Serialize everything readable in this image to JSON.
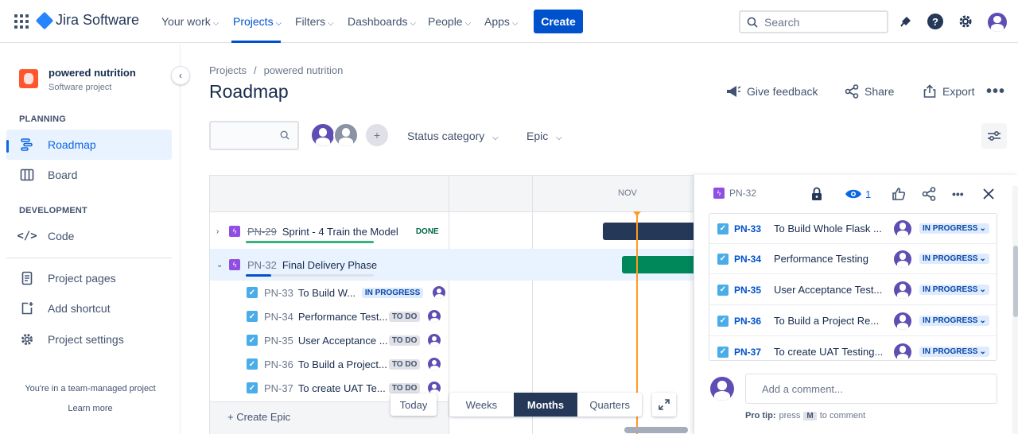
{
  "topnav": {
    "logo_text": "Jira Software",
    "items": [
      {
        "label": "Your work"
      },
      {
        "label": "Projects"
      },
      {
        "label": "Filters"
      },
      {
        "label": "Dashboards"
      },
      {
        "label": "People"
      },
      {
        "label": "Apps"
      }
    ],
    "create_label": "Create",
    "search_placeholder": "Search"
  },
  "sidebar": {
    "project_name": "powered nutrition",
    "project_type": "Software project",
    "planning_heading": "PLANNING",
    "development_heading": "DEVELOPMENT",
    "items": [
      {
        "label": "Roadmap",
        "icon": "roadmap-icon"
      },
      {
        "label": "Board",
        "icon": "board-icon"
      },
      {
        "label": "Code",
        "icon": "code-icon"
      },
      {
        "label": "Project pages",
        "icon": "pages-icon"
      },
      {
        "label": "Add shortcut",
        "icon": "add-shortcut-icon"
      },
      {
        "label": "Project settings",
        "icon": "gear-icon"
      }
    ],
    "team_managed_text": "You're in a team-managed project",
    "learn_more": "Learn more"
  },
  "header": {
    "breadcrumb": [
      "Projects",
      "/",
      "powered nutrition"
    ],
    "title": "Roadmap",
    "give_feedback": "Give feedback",
    "share": "Share",
    "export": "Export"
  },
  "filters": {
    "status_category": "Status category",
    "epic": "Epic"
  },
  "roadmap": {
    "month_label": "NOV",
    "rows": [
      {
        "key": "PN-29",
        "summary": "Sprint - 4 Train the Model",
        "status": "DONE"
      },
      {
        "key": "PN-32",
        "summary": "Final Delivery Phase",
        "status": ""
      },
      {
        "key": "PN-33",
        "summary": "To Build W...",
        "status": "IN PROGRESS"
      },
      {
        "key": "PN-34",
        "summary": "Performance Test...",
        "status": "TO DO"
      },
      {
        "key": "PN-35",
        "summary": "User Acceptance ...",
        "status": "TO DO"
      },
      {
        "key": "PN-36",
        "summary": "To Build a Project...",
        "status": "TO DO"
      },
      {
        "key": "PN-37",
        "summary": "To create UAT Te...",
        "status": "TO DO"
      }
    ],
    "create_epic": "+ Create Epic",
    "today": "Today",
    "zoom": [
      "Weeks",
      "Months",
      "Quarters"
    ],
    "colors": {
      "dark_bar": "#253858",
      "green_bar": "#00875a",
      "today": "#ff991f"
    }
  },
  "panel": {
    "issue_key": "PN-32",
    "watchers": "1",
    "children": [
      {
        "key": "PN-33",
        "summary": "To Build Whole Flask ...",
        "status": "IN PROGRESS"
      },
      {
        "key": "PN-34",
        "summary": "Performance Testing",
        "status": "IN PROGRESS"
      },
      {
        "key": "PN-35",
        "summary": "User Acceptance Test...",
        "status": "IN PROGRESS"
      },
      {
        "key": "PN-36",
        "summary": "To Build a Project Re...",
        "status": "IN PROGRESS"
      },
      {
        "key": "PN-37",
        "summary": "To create UAT Testing...",
        "status": "IN PROGRESS"
      }
    ],
    "comment_placeholder": "Add a comment...",
    "pro_tip_label": "Pro tip:",
    "pro_tip_press": "press",
    "pro_tip_key": "M",
    "pro_tip_rest": "to comment"
  }
}
